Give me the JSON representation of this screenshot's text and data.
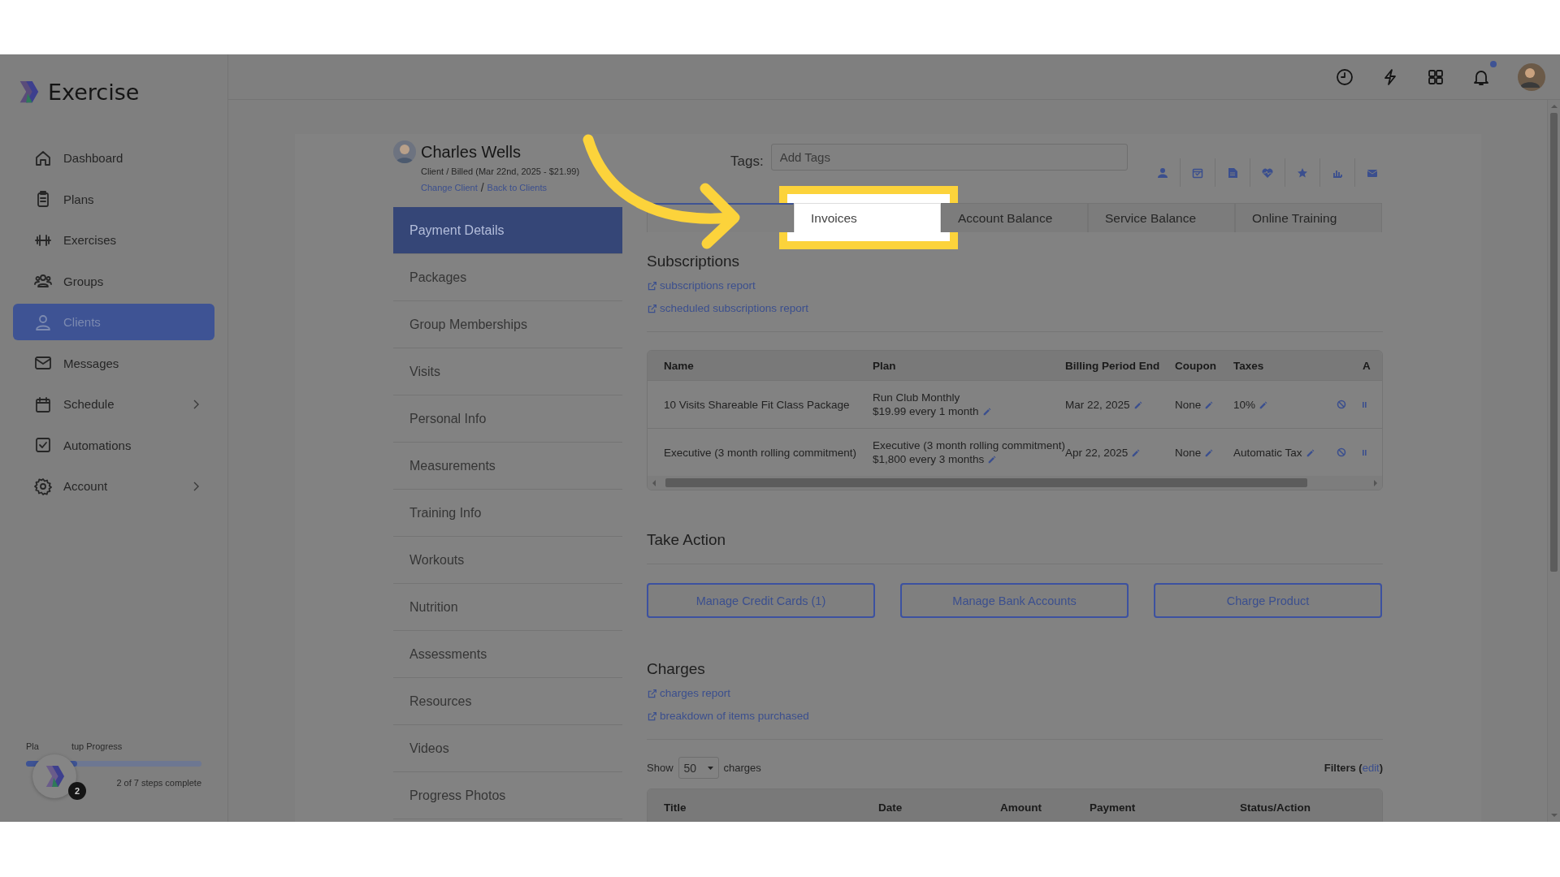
{
  "brand": {
    "name": "Exercise"
  },
  "nav": [
    {
      "label": "Dashboard",
      "kind": "home",
      "selected": false,
      "has_submenu": false
    },
    {
      "label": "Plans",
      "kind": "clipboard",
      "selected": false,
      "has_submenu": false
    },
    {
      "label": "Exercises",
      "kind": "dumbbell",
      "selected": false,
      "has_submenu": false
    },
    {
      "label": "Groups",
      "kind": "users",
      "selected": false,
      "has_submenu": false
    },
    {
      "label": "Clients",
      "kind": "user",
      "selected": true,
      "has_submenu": false
    },
    {
      "label": "Messages",
      "kind": "mail",
      "selected": false,
      "has_submenu": false
    },
    {
      "label": "Schedule",
      "kind": "calendar",
      "selected": false,
      "has_submenu": true
    },
    {
      "label": "Automations",
      "kind": "checkbox",
      "selected": false,
      "has_submenu": false
    },
    {
      "label": "Account",
      "kind": "gear",
      "selected": false,
      "has_submenu": true
    }
  ],
  "setup_progress": {
    "label_start": "Pla",
    "label_end": "tup Progress",
    "level": 0.29,
    "badge": "2",
    "status": "2 of 7 steps complete"
  },
  "header_icons": [
    {
      "kind": "clock"
    },
    {
      "kind": "bolt"
    },
    {
      "kind": "grid"
    },
    {
      "kind": "bell",
      "unread": true
    },
    {
      "kind": "avatar"
    }
  ],
  "client": {
    "name": "Charles Wells",
    "summary": "Client / Billed (Mar 22nd, 2025 - $21.99)",
    "links": [
      "Change Client",
      "Back to Clients"
    ],
    "separator": "/"
  },
  "tags": {
    "label": "Tags:",
    "placeholder": "Add Tags"
  },
  "tool_icons": [
    {
      "kind": "person"
    },
    {
      "kind": "calendar"
    },
    {
      "kind": "document"
    },
    {
      "kind": "heart"
    },
    {
      "kind": "star"
    },
    {
      "kind": "chart"
    },
    {
      "kind": "mail"
    }
  ],
  "client_menu": [
    {
      "label": "Payment Details",
      "selected": true
    },
    {
      "label": "Packages",
      "selected": false
    },
    {
      "label": "Group Memberships",
      "selected": false
    },
    {
      "label": "Visits",
      "selected": false
    },
    {
      "label": "Personal Info",
      "selected": false
    },
    {
      "label": "Measurements",
      "selected": false
    },
    {
      "label": "Training Info",
      "selected": false
    },
    {
      "label": "Workouts",
      "selected": false
    },
    {
      "label": "Nutrition",
      "selected": false
    },
    {
      "label": "Assessments",
      "selected": false
    },
    {
      "label": "Resources",
      "selected": false
    },
    {
      "label": "Videos",
      "selected": false
    },
    {
      "label": "Progress Photos",
      "selected": false
    }
  ],
  "tabs": [
    {
      "selected": true,
      "highlighted": false
    },
    {
      "label": "Invoices",
      "selected": false,
      "highlighted": true
    },
    {
      "label": "Account Balance",
      "selected": false,
      "highlighted": false
    },
    {
      "label": "Service Balance",
      "selected": false,
      "highlighted": false
    },
    {
      "label": "Online Training",
      "selected": false,
      "highlighted": false
    }
  ],
  "subscriptions": {
    "title": "Subscriptions",
    "links": [
      "subscriptions report",
      "scheduled subscriptions report"
    ],
    "columns": [
      "Name",
      "Plan",
      "Billing Period End",
      "Coupon",
      "Taxes",
      "A"
    ],
    "rows": [
      {
        "name": "10 Visits Shareable Fit Class Package",
        "plan": "Run Club Monthly",
        "price": "$19.99 every 1 month",
        "billing_end": "Mar 22, 2025",
        "coupon": "None",
        "taxes": "10%"
      },
      {
        "name": "Executive (3 month rolling commitment)",
        "plan": "Executive (3 month rolling commitment)",
        "price": "$1,800 every 3 months",
        "billing_end": "Apr 22, 2025",
        "coupon": "None",
        "taxes": "Automatic Tax"
      }
    ]
  },
  "take_action": {
    "title": "Take Action",
    "buttons": [
      "Manage Credit Cards (1)",
      "Manage Bank Accounts",
      "Charge Product"
    ]
  },
  "charges": {
    "title": "Charges",
    "links": [
      "charges report",
      "breakdown of items purchased"
    ],
    "show_label": "Show",
    "page_size": "50",
    "unit": "charges",
    "filters_before": "Filters (",
    "filters_link": "edit",
    "filters_after": ")",
    "columns": [
      "Title",
      "Date",
      "Amount",
      "Payment",
      "Status/Action"
    ]
  }
}
